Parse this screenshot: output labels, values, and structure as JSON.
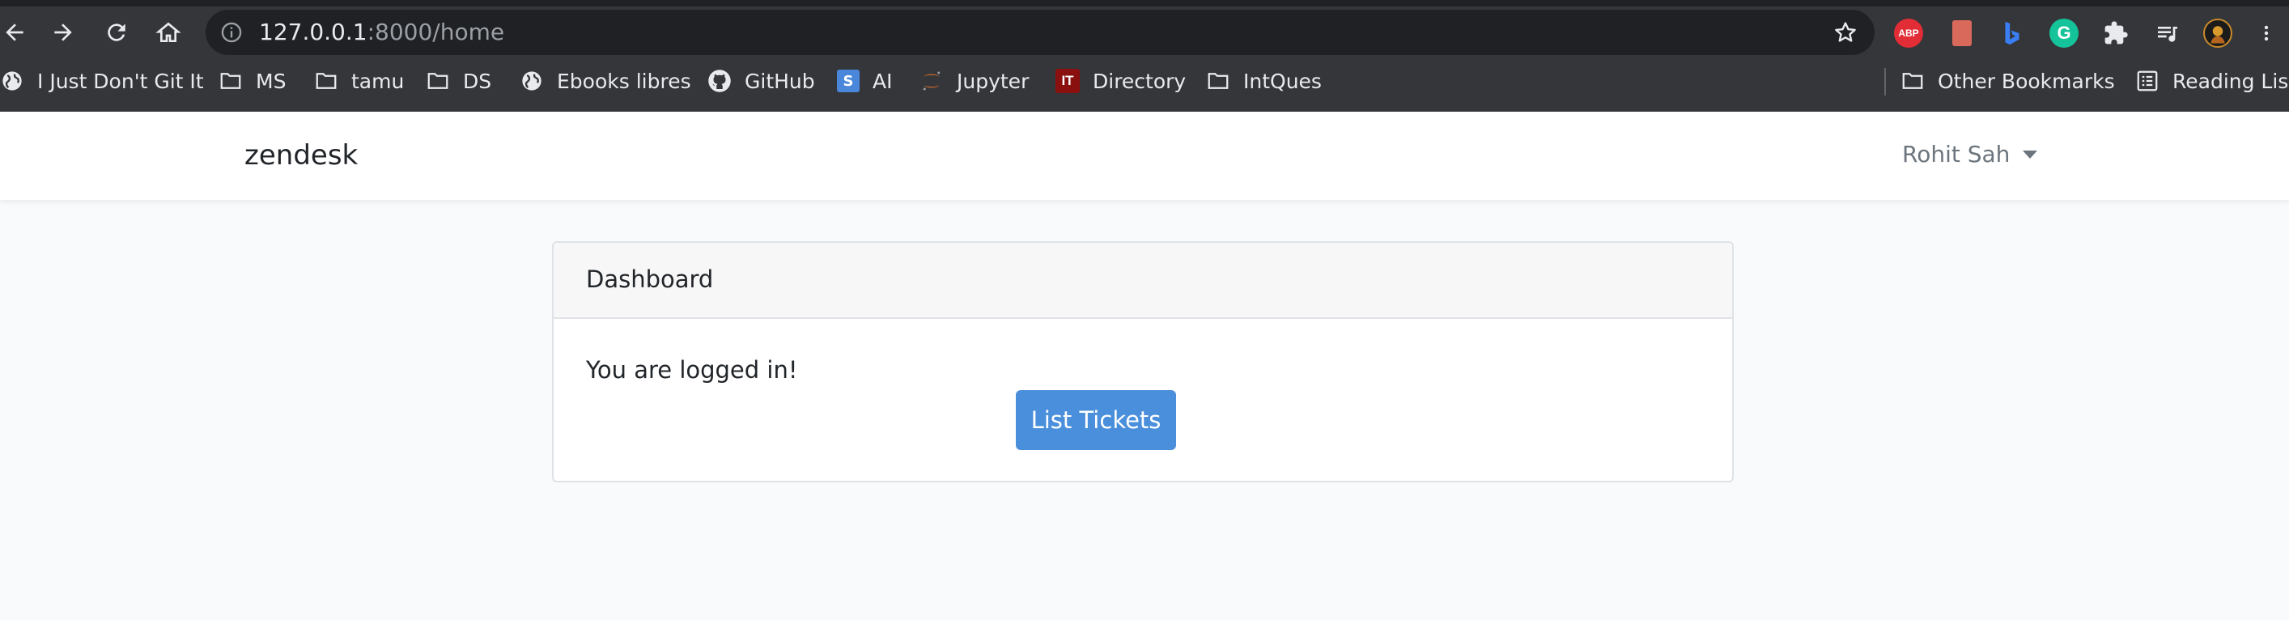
{
  "browser": {
    "url_host": "127.0.0.1",
    "url_rest": ":8000/home",
    "nav_icons": [
      "back-icon",
      "forward-icon",
      "reload-icon",
      "home-icon"
    ],
    "extensions": {
      "abp_label": "ABP",
      "grammarly_label": "G"
    }
  },
  "bookmarks": {
    "items": [
      {
        "label": "I Just Don't Git It",
        "icon": "globe-icon"
      },
      {
        "label": "MS",
        "icon": "folder-icon"
      },
      {
        "label": "tamu",
        "icon": "folder-icon"
      },
      {
        "label": "DS",
        "icon": "folder-icon"
      },
      {
        "label": "Ebooks libres",
        "icon": "globe-icon"
      },
      {
        "label": "GitHub",
        "icon": "github-icon"
      },
      {
        "label": "AI",
        "icon": "s-square-icon",
        "icon_text": "S"
      },
      {
        "label": "Jupyter",
        "icon": "jupyter-icon"
      },
      {
        "label": "Directory",
        "icon": "it-square-icon",
        "icon_text": "IT"
      },
      {
        "label": "IntQues",
        "icon": "folder-icon"
      }
    ],
    "other_label": "Other Bookmarks",
    "reading_list_label": "Reading List"
  },
  "app": {
    "brand": "zendesk",
    "user_name": "Rohit Sah"
  },
  "card": {
    "header": "Dashboard",
    "message": "You are logged in!",
    "button_label": "List Tickets"
  },
  "colors": {
    "chrome_bg": "#35363a",
    "omnibox_bg": "#202124",
    "page_bg": "#f8fafc",
    "primary": "#4a8fdb"
  }
}
